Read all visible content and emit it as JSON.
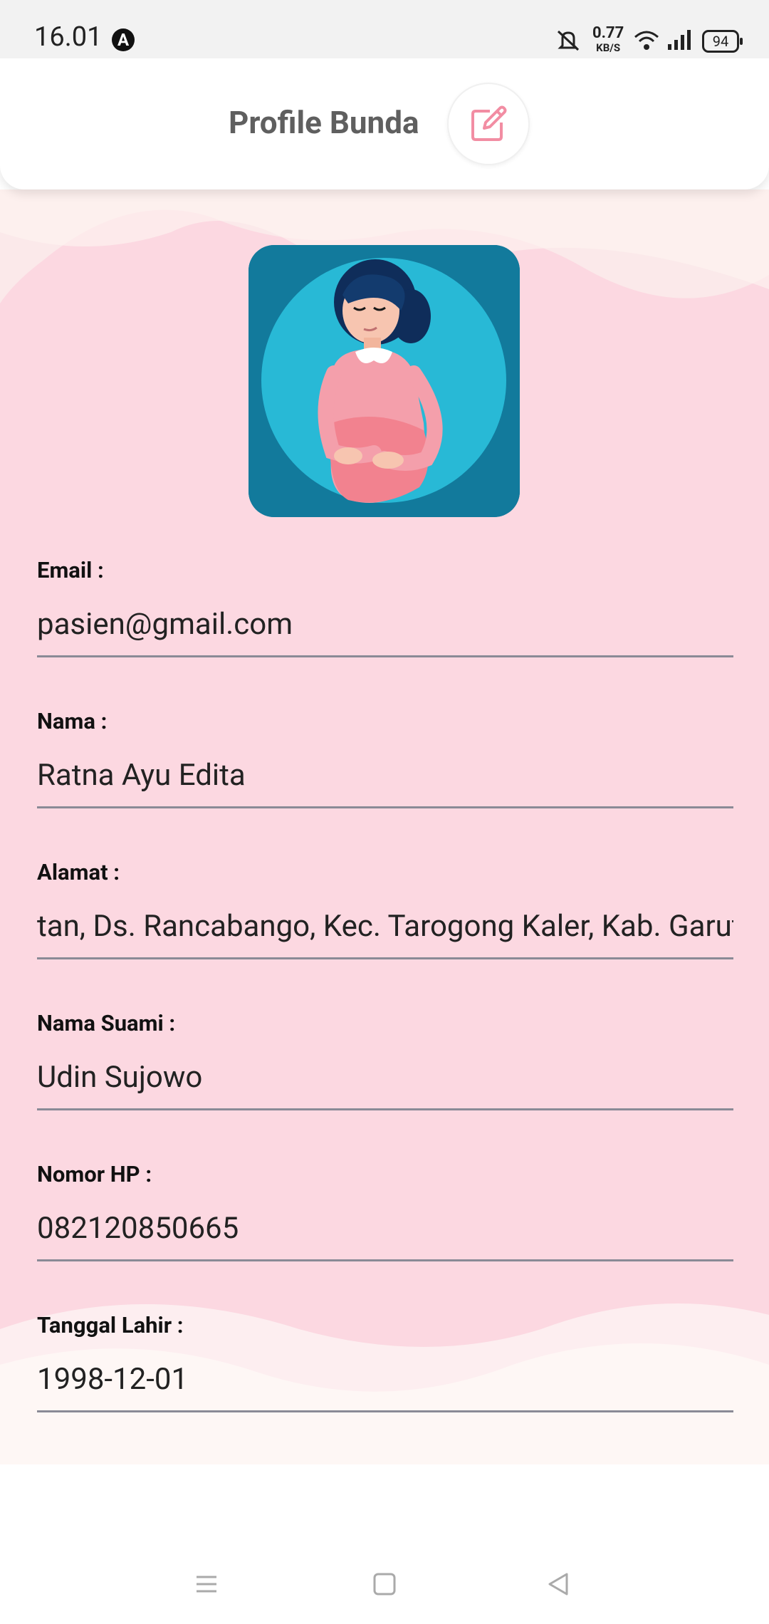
{
  "status_bar": {
    "time": "16.01",
    "speed_value": "0.77",
    "speed_unit": "KB/S",
    "battery": "94"
  },
  "header": {
    "title": "Profile Bunda",
    "edit_icon": "edit-icon"
  },
  "colors": {
    "accent": "#f28da3",
    "background": "#fcd8e1",
    "avatar_bg": "#127a9c"
  },
  "fields": [
    {
      "label": "Email :",
      "value": "pasien@gmail.com"
    },
    {
      "label": "Nama :",
      "value": "Ratna Ayu Edita"
    },
    {
      "label": "Alamat :",
      "value": "tan, Ds. Rancabango, Kec. Tarogong Kaler, Kab. Garut"
    },
    {
      "label": "Nama Suami :",
      "value": "Udin Sujowo"
    },
    {
      "label": "Nomor HP :",
      "value": "082120850665"
    },
    {
      "label": "Tanggal Lahir :",
      "value": "1998-12-01"
    }
  ]
}
